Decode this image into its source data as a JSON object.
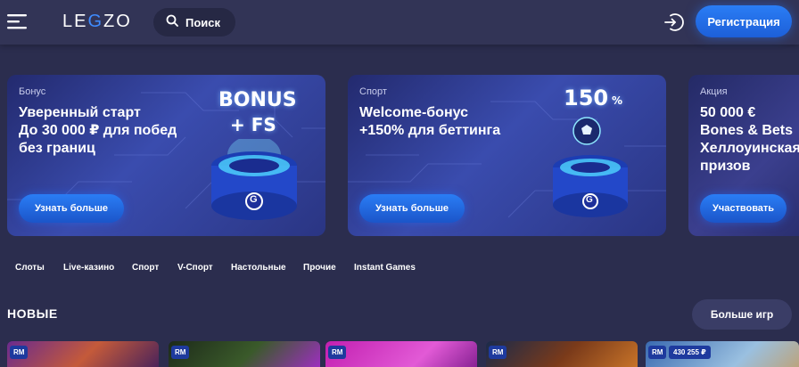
{
  "header": {
    "logo_text_a": "LE",
    "logo_text_g": "G",
    "logo_text_b": "ZO",
    "search_label": "Поиск",
    "register_label": "Регистрация",
    "accent_color": "#2a7df5"
  },
  "banners": [
    {
      "category": "Бонус",
      "title": "Уверенный старт\nДо 30 000 ₽ для побед\nбез границ",
      "cta": "Узнать больше",
      "promo_line1": "BONUS",
      "promo_line2": "+ FS",
      "logo_letter": "G"
    },
    {
      "category": "Спорт",
      "title": "Welcome-бонус\n+150% для беттинга",
      "cta": "Узнать больше",
      "promo_line1": "150",
      "promo_line2": "%",
      "logo_letter": "G"
    },
    {
      "category": "Акция",
      "title": "50 000 €\nBones & Bets\nХеллоуинская\nпризов",
      "cta": "Участвовать"
    }
  ],
  "categories": [
    "Слоты",
    "Live-казино",
    "Спорт",
    "V-Спорт",
    "Настольные",
    "Прочие",
    "Instant Games"
  ],
  "section": {
    "title": "НОВЫЕ",
    "more_label": "Больше игр"
  },
  "games": [
    {
      "badge": "RM"
    },
    {
      "badge": "RM"
    },
    {
      "badge": "RM"
    },
    {
      "badge": "RM"
    },
    {
      "badge": "RM",
      "jackpot": "430 255 ₽"
    }
  ]
}
